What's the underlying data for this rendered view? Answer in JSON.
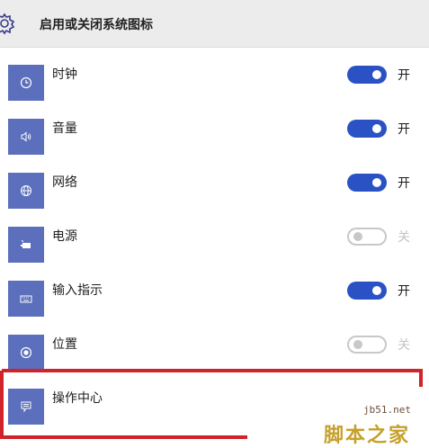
{
  "header": {
    "title": "启用或关闭系统图标",
    "icon": "gear-icon"
  },
  "items": [
    {
      "label": "时钟",
      "icon": "clock-icon",
      "on": true,
      "state": "开"
    },
    {
      "label": "音量",
      "icon": "volume-icon",
      "on": true,
      "state": "开"
    },
    {
      "label": "网络",
      "icon": "globe-icon",
      "on": true,
      "state": "开"
    },
    {
      "label": "电源",
      "icon": "battery-icon",
      "on": false,
      "state": "关"
    },
    {
      "label": "输入指示",
      "icon": "keyboard-icon",
      "on": true,
      "state": "开"
    },
    {
      "label": "位置",
      "icon": "location-icon",
      "on": false,
      "state": "关"
    },
    {
      "label": "操作中心",
      "icon": "message-icon",
      "on": null,
      "state": ""
    }
  ],
  "watermark": {
    "url": "jb51.net",
    "text": "脚本之家"
  },
  "colors": {
    "accent": "#2b52c4",
    "tile": "#5b6fbd",
    "highlight": "#d0232a"
  }
}
